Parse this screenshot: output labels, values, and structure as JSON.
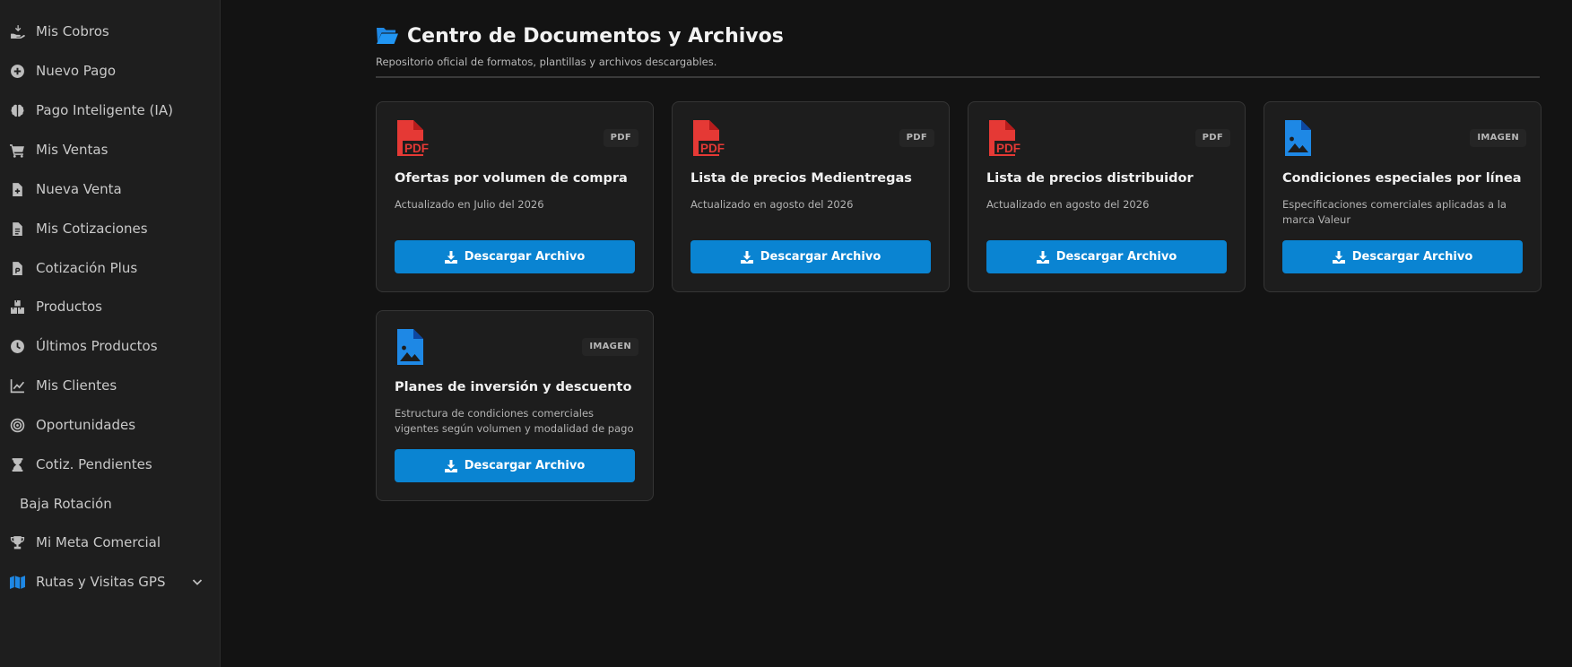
{
  "sidebar": {
    "items": [
      {
        "label": "Mis Cobros",
        "icon": "hand-money-icon"
      },
      {
        "label": "Nuevo Pago",
        "icon": "plus-circle-icon"
      },
      {
        "label": "Pago Inteligente (IA)",
        "icon": "brain-icon"
      },
      {
        "label": "Mis Ventas",
        "icon": "cart-icon"
      },
      {
        "label": "Nueva Venta",
        "icon": "file-plus-icon"
      },
      {
        "label": "Mis Cotizaciones",
        "icon": "file-text-icon"
      },
      {
        "label": "Cotización Plus",
        "icon": "file-invoice-icon"
      },
      {
        "label": "Productos",
        "icon": "boxes-icon"
      },
      {
        "label": "Últimos Productos",
        "icon": "clock-icon"
      },
      {
        "label": "Mis Clientes",
        "icon": "chart-line-icon"
      },
      {
        "label": "Oportunidades",
        "icon": "target-icon"
      },
      {
        "label": "Cotiz. Pendientes",
        "icon": "hourglass-icon"
      },
      {
        "label": "Baja Rotación",
        "icon": ""
      },
      {
        "label": "Mi Meta Comercial",
        "icon": "trophy-icon"
      },
      {
        "label": "Rutas y Visitas GPS",
        "icon": "map-icon"
      }
    ]
  },
  "header": {
    "icon": "folder-open-icon",
    "title": "Centro de Documentos y Archivos",
    "subtitle": "Repositorio oficial de formatos, plantillas y archivos descargables."
  },
  "documents": [
    {
      "type": "PDF",
      "title": "Ofertas por volumen de compra",
      "description": "Actualizado en Julio del 2026",
      "button": "Descargar Archivo"
    },
    {
      "type": "PDF",
      "title": "Lista de precios Medientregas",
      "description": "Actualizado en agosto del 2026",
      "button": "Descargar Archivo"
    },
    {
      "type": "PDF",
      "title": "Lista de precios distribuidor",
      "description": "Actualizado en agosto del 2026",
      "button": "Descargar Archivo"
    },
    {
      "type": "IMAGEN",
      "title": "Condiciones especiales por línea",
      "description": "Especificaciones comerciales aplicadas a la marca Valeur",
      "button": "Descargar Archivo"
    },
    {
      "type": "IMAGEN",
      "title": "Planes de inversión y descuento",
      "description": "Estructura de condiciones comerciales vigentes según volumen y modalidad de pago",
      "button": "Descargar Archivo"
    }
  ],
  "colors": {
    "accent": "#0a84d2",
    "pdf": "#e53935",
    "image": "#1e88e5",
    "background": "#131313",
    "sidebar": "#1e1e1e",
    "card": "#1d1d1d"
  }
}
